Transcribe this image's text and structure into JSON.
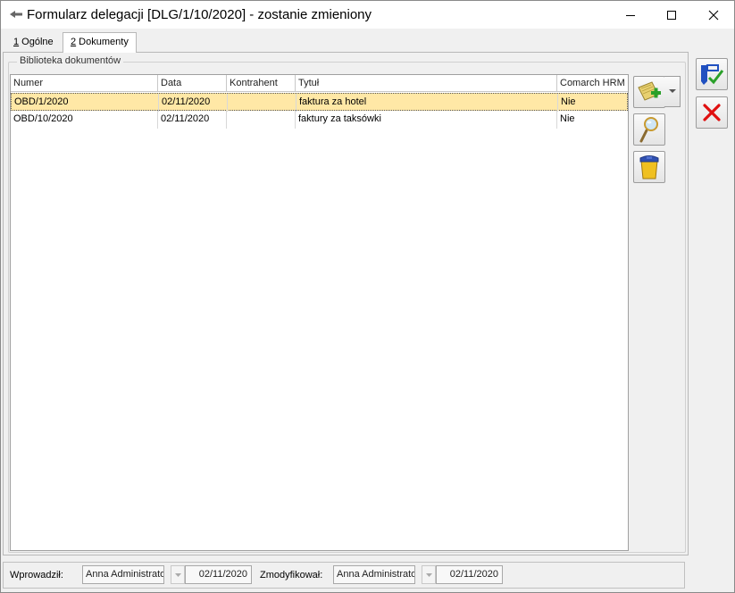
{
  "window": {
    "title": "Formularz delegacji [DLG/1/10/2020] - zostanie zmieniony",
    "icon": "arrow-icon",
    "controls": [
      "minimize-icon",
      "maximize-icon",
      "close-icon"
    ]
  },
  "tabs": [
    {
      "key": "1",
      "label": " Ogólne",
      "active": false
    },
    {
      "key": "2",
      "label": " Dokumenty",
      "active": true
    }
  ],
  "group": {
    "label": "Biblioteka dokumentów"
  },
  "grid": {
    "columns": [
      "Numer",
      "Data",
      "Kontrahent",
      "Tytuł",
      "Comarch HRM"
    ],
    "rows": [
      {
        "numer": "OBD/1/2020",
        "data": "02/11/2020",
        "kontrahent": "",
        "tytul": "faktura za hotel",
        "hrm": "Nie",
        "selected": true
      },
      {
        "numer": "OBD/10/2020",
        "data": "02/11/2020",
        "kontrahent": "",
        "tytul": "faktury za taksówki",
        "hrm": "Nie",
        "selected": false
      }
    ]
  },
  "side_buttons": [
    "add-document-icon",
    "dropdown-arrow-icon",
    "magnifier-icon",
    "trash-bin-icon"
  ],
  "right_buttons": [
    "save-icon",
    "cancel-x-icon"
  ],
  "footer": {
    "entered_label": "Wprowadził:",
    "entered_by": "Anna Administrator",
    "entered_date": "02/11/2020",
    "modified_label": "Zmodyfikował:",
    "modified_by": "Anna Administrator",
    "modified_date": "02/11/2020"
  },
  "colors": {
    "selected_row": "#ffe8a6",
    "cancel_red": "#e01010",
    "save_blue": "#2050c0",
    "accent_green": "#2aa02a"
  }
}
